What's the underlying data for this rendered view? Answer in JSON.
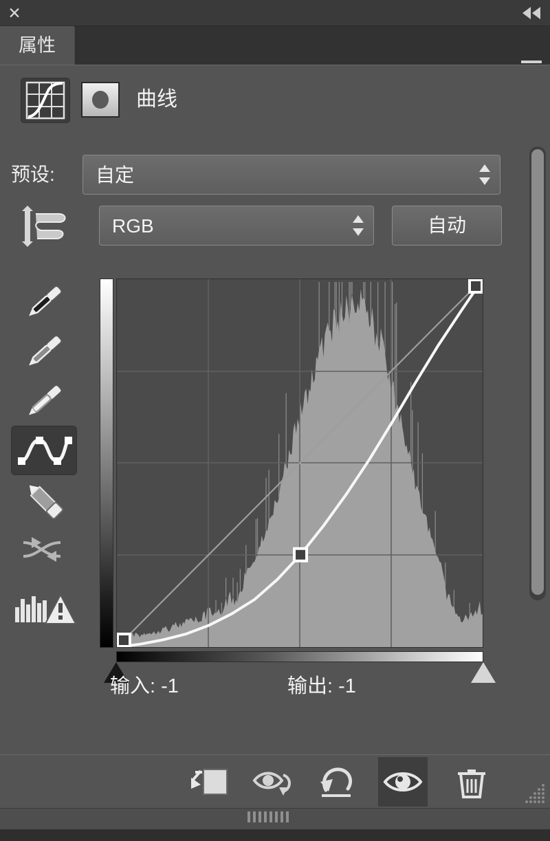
{
  "window": {
    "close_label": "✕",
    "collapse_icon": "double-chevron-left-icon"
  },
  "tabs": [
    {
      "label": "属性",
      "active": true
    }
  ],
  "panel_menu": {
    "icon": "panel-menu-icon"
  },
  "adjustment": {
    "icon": "curves-adjustment-icon",
    "mask_thumbnail": "layer-mask-thumbnail",
    "title": "曲线"
  },
  "preset": {
    "label": "预设:",
    "value": "自定",
    "options": [
      "自定"
    ]
  },
  "channel": {
    "icon": "target-adjustment-icon",
    "value": "RGB",
    "options": [
      "RGB"
    ],
    "auto_label": "自动"
  },
  "tools": [
    {
      "name": "black-point-eyedropper-icon",
      "active": false
    },
    {
      "name": "gray-point-eyedropper-icon",
      "active": false
    },
    {
      "name": "white-point-eyedropper-icon",
      "active": false
    },
    {
      "name": "curve-point-tool-icon",
      "active": true
    },
    {
      "name": "pencil-draw-curve-icon",
      "active": false
    },
    {
      "name": "smooth-curve-icon",
      "active": false
    },
    {
      "name": "clipping-warning-icon",
      "active": false
    }
  ],
  "readout": {
    "input_label": "输入:",
    "input_value": "-1",
    "output_label": "输出:",
    "output_value": "-1",
    "input_text": "输入: -1",
    "output_text": "输出: -1"
  },
  "sliders": {
    "black_point_handle": "black-point-handle",
    "white_point_handle": "white-point-handle"
  },
  "footer": {
    "buttons": [
      {
        "name": "clip-to-layer-button",
        "icon": "clip-to-layer-icon",
        "active": false
      },
      {
        "name": "toggle-preview-button",
        "icon": "eye-with-arrow-icon",
        "active": false
      },
      {
        "name": "reset-adjustment-button",
        "icon": "reset-arrow-icon",
        "active": false
      },
      {
        "name": "toggle-visibility-button",
        "icon": "eye-icon",
        "active": true
      },
      {
        "name": "delete-adjustment-button",
        "icon": "trash-icon",
        "active": false
      }
    ]
  },
  "colors": {
    "panel_bg": "#545454",
    "titlebar_bg": "#3a3a3a",
    "tabbar_bg": "#323232",
    "graph_bg": "#4b4b4b",
    "grid_line": "#5e5e5e",
    "curve_line": "#f5f5f5",
    "baseline": "#9a9a9a",
    "histogram": "#a6a6a6",
    "text": "#f0f0f0",
    "control_border": "#8a8a8a",
    "scroll_thumb": "#8c8c8c"
  },
  "chart_data": {
    "type": "line",
    "title": "曲线 (Curves) RGB",
    "xlabel": "输入 (Input)",
    "ylabel": "输出 (Output)",
    "xlim": [
      0,
      255
    ],
    "ylim": [
      0,
      255
    ],
    "grid": true,
    "grid_divisions": 4,
    "legend": "none",
    "series": [
      {
        "name": "baseline-diagonal",
        "type": "line",
        "x": [
          0,
          255
        ],
        "y": [
          0,
          255
        ],
        "style": "thin-gray-reference"
      },
      {
        "name": "rgb-curve",
        "type": "line",
        "style": "white-spline",
        "control_points": [
          {
            "input": 0,
            "output": 0
          },
          {
            "input": 128,
            "output": 64
          },
          {
            "input": 255,
            "output": 255
          }
        ],
        "x": [
          0,
          16,
          32,
          48,
          64,
          80,
          96,
          112,
          128,
          144,
          160,
          176,
          192,
          208,
          224,
          240,
          255
        ],
        "y": [
          0,
          2,
          5,
          9,
          15,
          23,
          33,
          47,
          64,
          84,
          106,
          130,
          156,
          183,
          209,
          233,
          255
        ]
      },
      {
        "name": "histogram",
        "type": "area",
        "x": [
          0,
          8,
          16,
          24,
          32,
          40,
          48,
          56,
          64,
          72,
          80,
          88,
          96,
          104,
          112,
          120,
          128,
          136,
          144,
          152,
          160,
          168,
          176,
          184,
          192,
          200,
          208,
          216,
          224,
          232,
          240,
          248,
          255
        ],
        "y": [
          3,
          4,
          4,
          5,
          6,
          7,
          8,
          9,
          11,
          13,
          16,
          20,
          26,
          34,
          44,
          56,
          68,
          78,
          88,
          94,
          98,
          100,
          96,
          88,
          76,
          62,
          48,
          36,
          26,
          16,
          9,
          10,
          14
        ],
        "note": "normalized counts 0-100; peak near input 168"
      }
    ]
  }
}
